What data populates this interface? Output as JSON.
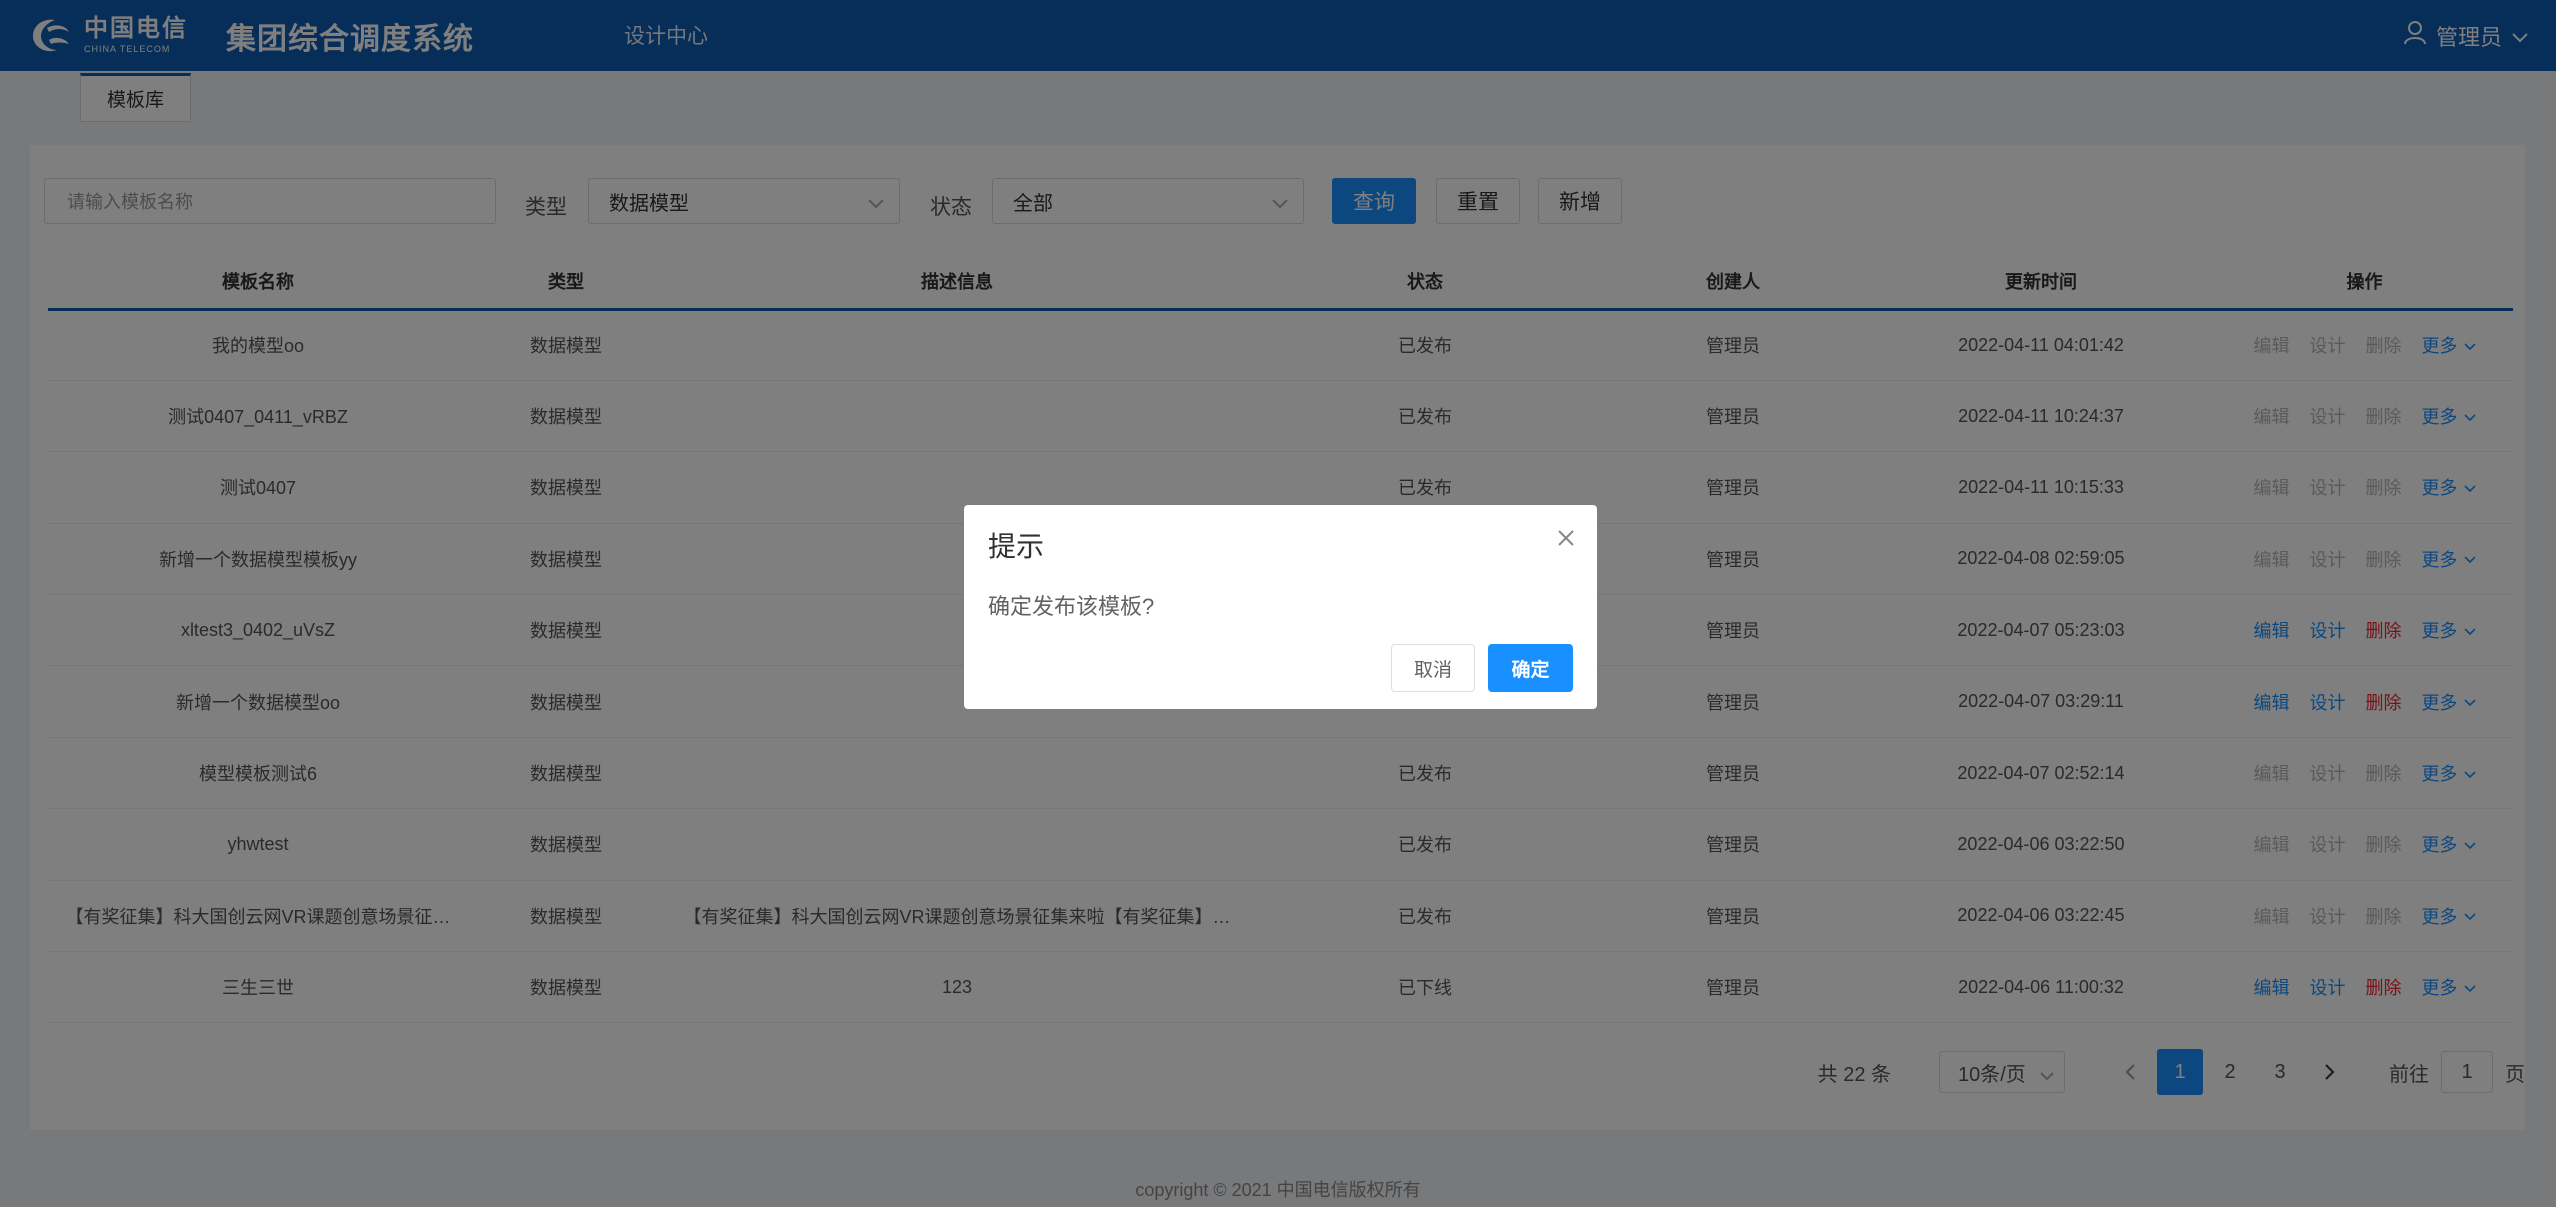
{
  "header": {
    "logo_cn": "中国电信",
    "logo_en": "CHINA TELECOM",
    "system_title": "集团综合调度系统",
    "nav_item": "设计中心",
    "user_name": "管理员"
  },
  "tabs": [
    {
      "label": "模板库"
    }
  ],
  "filters": {
    "name_placeholder": "请输入模板名称",
    "type_label": "类型",
    "type_value": "数据模型",
    "status_label": "状态",
    "status_value": "全部",
    "query_label": "查询",
    "reset_label": "重置",
    "add_label": "新增"
  },
  "table": {
    "columns": [
      "模板名称",
      "类型",
      "描述信息",
      "状态",
      "创建人",
      "更新时间",
      "操作"
    ],
    "rows": [
      {
        "name": "我的模型oo",
        "type": "数据模型",
        "desc": "",
        "status": "已发布",
        "creator": "管理员",
        "updated": "2022-04-11 04:01:42",
        "enabled": false
      },
      {
        "name": "测试0407_0411_vRBZ",
        "type": "数据模型",
        "desc": "",
        "status": "已发布",
        "creator": "管理员",
        "updated": "2022-04-11 10:24:37",
        "enabled": false
      },
      {
        "name": "测试0407",
        "type": "数据模型",
        "desc": "",
        "status": "已发布",
        "creator": "管理员",
        "updated": "2022-04-11 10:15:33",
        "enabled": false
      },
      {
        "name": "新增一个数据模型模板yy",
        "type": "数据模型",
        "desc": "",
        "status": "",
        "creator": "管理员",
        "updated": "2022-04-08 02:59:05",
        "enabled": false
      },
      {
        "name": "xltest3_0402_uVsZ",
        "type": "数据模型",
        "desc": "",
        "status": "",
        "creator": "管理员",
        "updated": "2022-04-07 05:23:03",
        "enabled": true
      },
      {
        "name": "新增一个数据模型oo",
        "type": "数据模型",
        "desc": "",
        "status": "",
        "creator": "管理员",
        "updated": "2022-04-07 03:29:11",
        "enabled": true
      },
      {
        "name": "模型模板测试6",
        "type": "数据模型",
        "desc": "",
        "status": "已发布",
        "creator": "管理员",
        "updated": "2022-04-07 02:52:14",
        "enabled": false
      },
      {
        "name": "yhwtest",
        "type": "数据模型",
        "desc": "",
        "status": "已发布",
        "creator": "管理员",
        "updated": "2022-04-06 03:22:50",
        "enabled": false
      },
      {
        "name": "【有奖征集】科大国创云网VR课题创意场景征…",
        "type": "数据模型",
        "desc": "【有奖征集】科大国创云网VR课题创意场景征集来啦【有奖征集】…",
        "status": "已发布",
        "creator": "管理员",
        "updated": "2022-04-06 03:22:45",
        "enabled": false
      },
      {
        "name": "三生三世",
        "type": "数据模型",
        "desc": "123",
        "status": "已下线",
        "creator": "管理员",
        "updated": "2022-04-06 11:00:32",
        "enabled": true
      }
    ],
    "actions": {
      "edit": "编辑",
      "design": "设计",
      "delete": "删除",
      "more": "更多"
    }
  },
  "pagination": {
    "total": "共 22 条",
    "page_size": "10条/页",
    "pages": [
      "1",
      "2",
      "3"
    ],
    "current": "1",
    "goto_prefix": "前往",
    "goto_value": "1",
    "goto_suffix": "页"
  },
  "footer": "copyright © 2021 中国电信版权所有",
  "dialog": {
    "title": "提示",
    "message": "确定发布该模板?",
    "cancel": "取消",
    "confirm": "确定"
  },
  "colors": {
    "header_bg": "#0d5cb0",
    "primary": "#1890ff",
    "danger": "#f5222d",
    "mask": "rgba(0,0,0,0.5)"
  }
}
